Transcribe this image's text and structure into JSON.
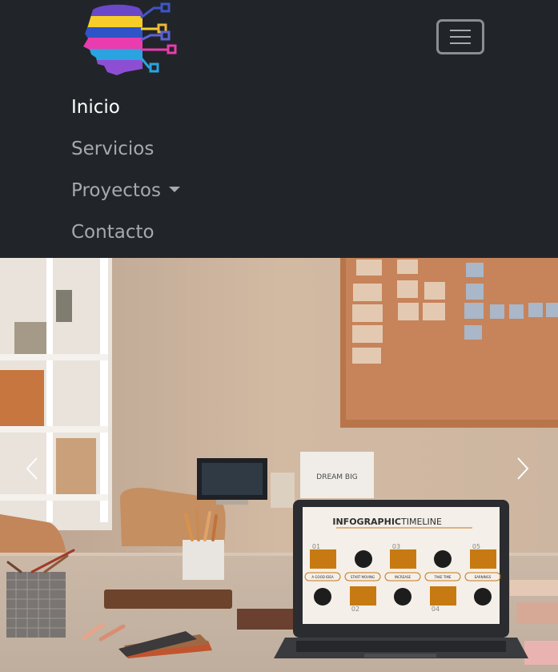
{
  "brand": {
    "logo_icon": "head-circuit-logo"
  },
  "toggler": {
    "icon": "hamburger-icon"
  },
  "nav": {
    "items": [
      {
        "label": "Inicio"
      },
      {
        "label": "Servicios"
      },
      {
        "label": "Proyectos"
      },
      {
        "label": "Contacto"
      }
    ]
  },
  "carousel": {
    "prev_icon": "chevron-left-icon",
    "next_icon": "chevron-right-icon",
    "slide": {
      "laptop_screen": {
        "title_bold": "INFOGRAPHIC",
        "title_light": " TIMELINE",
        "steps": [
          "A GOOD IDEA",
          "START MOVING",
          "INCREASE",
          "TAKE TIME",
          "EARNINGS"
        ],
        "numbers": [
          "01",
          "02",
          "03",
          "04",
          "05"
        ]
      },
      "monitor_sign": "DREAM BIG"
    }
  },
  "colors": {
    "navbar_bg": "#212529",
    "nav_active": "#ffffff",
    "nav_link": "#a7a9ac",
    "accent_orange": "#c77a12"
  }
}
